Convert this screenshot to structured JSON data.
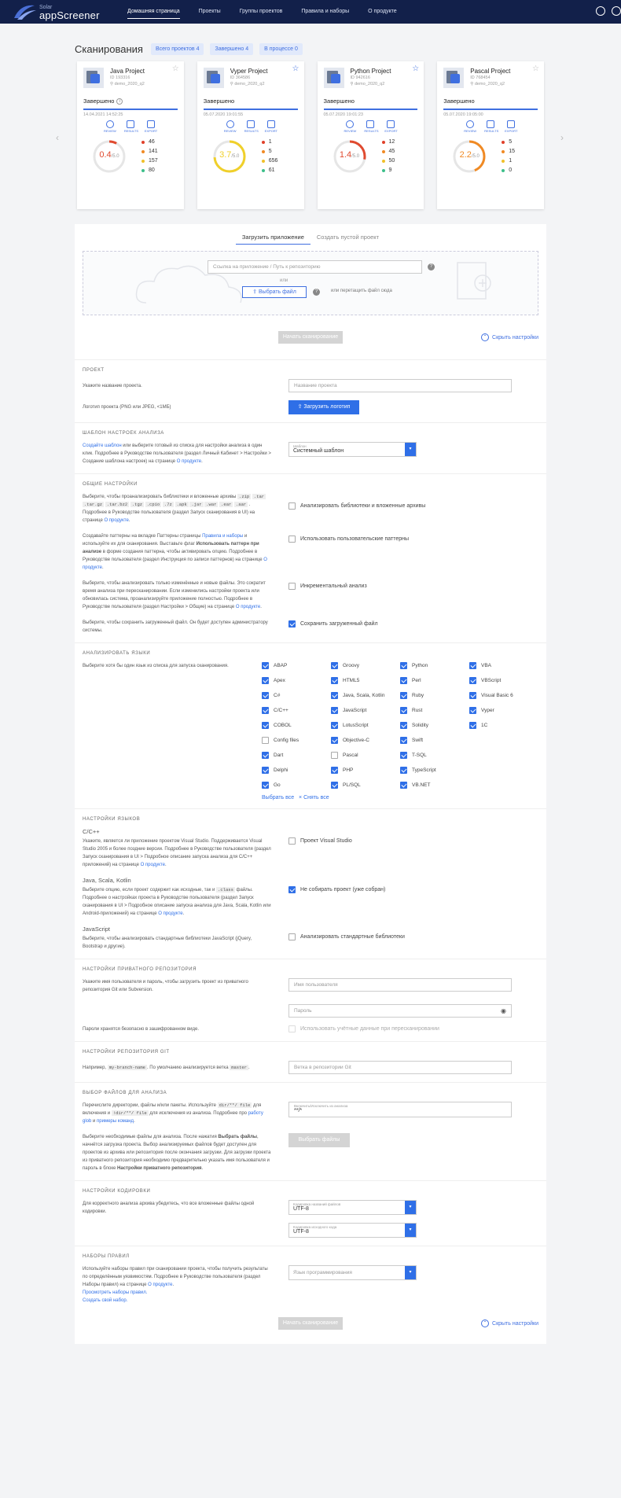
{
  "nav": {
    "brand_small": "Solar",
    "brand": "appScreener",
    "links": [
      "Домашняя страница",
      "Проекты",
      "Группы проектов",
      "Правила и наборы",
      "О продукте"
    ]
  },
  "header": {
    "title": "Сканирования",
    "total": "Всего проектов 4",
    "done": "Завершено 4",
    "in_progress": "В процессе 0"
  },
  "cards": [
    {
      "name": "Java Project",
      "id": "ID 193316",
      "user": "demo_2020_q2",
      "status": "Завершено",
      "date": "14.04.2021 14:52:25",
      "score": "0.4",
      "max": "/5.0",
      "color": "#e04a2f",
      "counts": [
        "46",
        "141",
        "157",
        "80"
      ]
    },
    {
      "name": "Vyper Project",
      "id": "ID 364586",
      "user": "demo_2020_q2",
      "status": "Завершено",
      "date": "05.07.2020 19:01:55",
      "score": "3.7",
      "max": "/5.0",
      "color": "#f0d02a",
      "counts": [
        "1",
        "5",
        "656",
        "61"
      ]
    },
    {
      "name": "Python Project",
      "id": "ID 942616",
      "user": "demo_2020_q2",
      "status": "Завершено",
      "date": "05.07.2020 19:01:23",
      "score": "1.4",
      "max": "/5.0",
      "color": "#e04a2f",
      "counts": [
        "12",
        "45",
        "50",
        "9"
      ]
    },
    {
      "name": "Pascal Project",
      "id": "ID 768454",
      "user": "demo_2020_q2",
      "status": "Завершено",
      "date": "05.07.2020 19:05:00",
      "score": "2.2",
      "max": "/5.0",
      "color": "#f08a24",
      "counts": [
        "5",
        "15",
        "1",
        "0"
      ]
    }
  ],
  "card_actions": [
    "REVIEW",
    "RESULTS",
    "EXPORT"
  ],
  "severity_colors": [
    "#e0402a",
    "#f08a24",
    "#f0c02a",
    "#3dbf8a"
  ],
  "upload": {
    "tab1": "Загрузить приложение",
    "tab2": "Создать пустой проект",
    "link_placeholder": "Ссылка на приложение / Путь к репозиторию",
    "or": "или",
    "select_file": "Выбрать файл",
    "drag": "или перетащить файл сюда",
    "start": "Начать сканирование",
    "hide": "Скрыть настройки"
  },
  "project": {
    "title": "ПРОЕКТ",
    "name_label": "Укажите название проекта.",
    "name_placeholder": "Название проекта",
    "logo_label": "Логотип проекта (PNG или JPEG, <1МБ)",
    "logo_btn": "Загрузить логотип"
  },
  "template": {
    "title": "ШАБЛОН НАСТРОЕК АНАЛИЗА",
    "link": "Создайте шаблон",
    "desc": " или выберите готовый из списка для настройки анализа в один клик. Подробнее в Руководстве пользователя (раздел Личный Кабинет > Настройки > Создание шаблона настроек) на странице ",
    "about": "О продукте",
    "sel_label": "Шаблон",
    "sel_value": "Системный шаблон"
  },
  "general": {
    "title": "ОБЩИЕ НАСТРОЙКИ",
    "libs_desc_a": "Выберите, чтобы проанализировать библиотеки и вложенные архивы",
    "libs_exts": [
      ".zip",
      ".tar",
      ".tar.gz",
      ".tar.bz2",
      ".tgz",
      ".cpio",
      ".7z",
      ".apk",
      ".jar",
      ".war",
      ".ear",
      ".aar"
    ],
    "libs_desc_b": ". Подробнее в Руководстве пользователя (раздел Запуск сканирования в UI) на странице ",
    "libs_chk": "Анализировать библиотеки и вложенные архивы",
    "patterns_desc_a": "Создавайте паттерны на вкладке Паттерны страницы ",
    "patterns_link": "Правила и наборы",
    "patterns_desc_b": " и используйте их для сканирования. Выставьте флаг ",
    "patterns_bold": "Использовать паттерн при анализе",
    "patterns_desc_c": " в форме создания паттерна, чтобы активировать опцию. Подробнее в Руководстве пользователя (раздел Инструкция по записи паттернов) на странице ",
    "patterns_chk": "Использовать пользовательские паттерны",
    "incr_desc": "Выберите, чтобы анализировать только изменённые и новые файлы. Это сократит время анализа при пересканировании. Если изменились настройки проекта или обновилась система, проанализируйте приложение полностью. Подробнее в Руководстве пользователя (раздел Настройки > Общие) на странице ",
    "incr_chk": "Инкрементальный анализ",
    "save_desc": "Выберите, чтобы сохранить загруженный файл. Он будет доступен администратору системы.",
    "save_chk": "Сохранить загруженный файл",
    "about": "О продукте"
  },
  "languages": {
    "title": "АНАЛИЗИРОВАТЬ ЯЗЫКИ",
    "desc": "Выберите хотя бы один язык из списка для запуска сканирования.",
    "items": [
      {
        "name": "ABAP",
        "on": true
      },
      {
        "name": "Groovy",
        "on": true
      },
      {
        "name": "Python",
        "on": true
      },
      {
        "name": "VBA",
        "on": true
      },
      {
        "name": "Apex",
        "on": true
      },
      {
        "name": "HTML5",
        "on": true
      },
      {
        "name": "Perl",
        "on": true
      },
      {
        "name": "VBScript",
        "on": true
      },
      {
        "name": "C#",
        "on": true
      },
      {
        "name": "Java, Scala, Kotlin",
        "on": true
      },
      {
        "name": "Ruby",
        "on": true
      },
      {
        "name": "Visual Basic 6",
        "on": true
      },
      {
        "name": "C/C++",
        "on": true
      },
      {
        "name": "JavaScript",
        "on": true
      },
      {
        "name": "Rust",
        "on": true
      },
      {
        "name": "Vyper",
        "on": true
      },
      {
        "name": "COBOL",
        "on": true
      },
      {
        "name": "LotusScript",
        "on": true
      },
      {
        "name": "Solidity",
        "on": true
      },
      {
        "name": "1C",
        "on": true
      },
      {
        "name": "Config files",
        "on": false
      },
      {
        "name": "Objective-C",
        "on": true
      },
      {
        "name": "Swift",
        "on": true
      },
      {
        "name": "",
        "on": null
      },
      {
        "name": "Dart",
        "on": true
      },
      {
        "name": "Pascal",
        "on": false
      },
      {
        "name": "T-SQL",
        "on": true
      },
      {
        "name": "",
        "on": null
      },
      {
        "name": "Delphi",
        "on": true
      },
      {
        "name": "PHP",
        "on": true
      },
      {
        "name": "TypeScript",
        "on": true
      },
      {
        "name": "",
        "on": null
      },
      {
        "name": "Go",
        "on": true
      },
      {
        "name": "PL/SQL",
        "on": true
      },
      {
        "name": "VB.NET",
        "on": true
      },
      {
        "name": "",
        "on": null
      }
    ],
    "select_all": "Выбрать все",
    "clear_all": "× Снять все"
  },
  "lang_settings": {
    "title": "НАСТРОЙКИ ЯЗЫКОВ",
    "cpp_head": "C/C++",
    "cpp_desc": "Укажите, является ли приложение проектом Visual Studio. Поддерживается Visual Studio 2005 и более поздние версии. Подробнее в Руководстве пользователя (раздел Запуск сканирования в UI > Подробное описание запуска анализа для C/C++ приложений) на странице ",
    "cpp_chk": "Проект Visual Studio",
    "java_head": "Java, Scala, Kotlin",
    "java_desc_a": "Выберите опцию, если проект содержит как исходные, так и ",
    "java_code": ".class",
    "java_desc_b": " файлы. Подробнее о настройках проекта в Руководстве пользователя (раздел Запуск сканирования в UI > Подробное описание запуска анализа для Java, Scala, Kotlin или Android-приложений) на странице ",
    "java_chk": "Не собирать проект (уже собран)",
    "js_head": "JavaScript",
    "js_desc": "Выберите, чтобы анализировать стандартные библиотеки JavaScript (jQuery, Bootstrap и другие).",
    "js_chk": "Анализировать стандартные библиотеки",
    "about": "О продукте"
  },
  "repo": {
    "title": "НАСТРОЙКИ ПРИВАТНОГО РЕПОЗИТОРИЯ",
    "desc": "Укажите имя пользователя и пароль, чтобы загрузить проект из приватного репозитория Git или Subversion.",
    "user_ph": "Имя пользователя",
    "pass_ph": "Пароль",
    "note": "Пароли хранятся безопасно в зашифрованном виде.",
    "use_chk": "Использовать учётные данные при пересканировании"
  },
  "git": {
    "title": "НАСТРОЙКИ РЕПОЗИТОРИЯ GIT",
    "desc_a": "Например, ",
    "code1": "my-branch-name",
    "desc_b": ". По умолчанию анализируется ветка ",
    "code2": "master",
    "desc_c": ".",
    "ph": "Ветка в репозитории Git"
  },
  "files": {
    "title": "ВЫБОР ФАЙЛОВ ДЛЯ АНАЛИЗА",
    "desc_a": "Перечислите директории, файлы и/или пакеты. Используйте ",
    "code1": "dir/**/ file",
    "desc_b": " для включения и ",
    "code2": "!dir/**/ file",
    "desc_c": " для исключения из анализа. Подробнее про ",
    "link1": "работу glob",
    "desc_d": " и ",
    "link2": "примеры команд",
    "desc_e": ".",
    "incl_label": "Включить/Исключить из анализа",
    "incl_value": "**/*",
    "choose_desc_a": "Выберите необходимые файлы для анализа. После нажатия ",
    "choose_bold": "Выбрать файлы",
    "choose_desc_b": ", начнётся загрузка проекта. Выбор анализируемых файлов будет доступен для проектов из архива или репозитория после окончания загрузки. Для загрузки проекта из приватного репозитория необходимо предварительно указать имя пользователя и пароль в блоке ",
    "choose_bold2": "Настройки приватного репозитория",
    "choose_btn": "Выбрать файлы"
  },
  "encoding": {
    "title": "НАСТРОЙКИ КОДИРОВКИ",
    "desc": "Для корректного анализа архива убедитесь, что все вложенные файлы одной кодировки.",
    "f1_label": "Кодировка названий файлов",
    "f1_value": "UTF-8",
    "f2_label": "Кодировка исходного кода",
    "f2_value": "UTF-8"
  },
  "rules": {
    "title": "НАБОРЫ ПРАВИЛ",
    "desc": "Используйте наборы правил при сканировании проекта, чтобы получить результаты по определённым уязвимостям. Подробнее в Руководстве пользователя (раздел Наборы правил) на странице ",
    "view": "Просмотреть наборы правил.",
    "create": "Создать свой набор.",
    "ph": "Язык программирования",
    "about": "О продукте"
  }
}
